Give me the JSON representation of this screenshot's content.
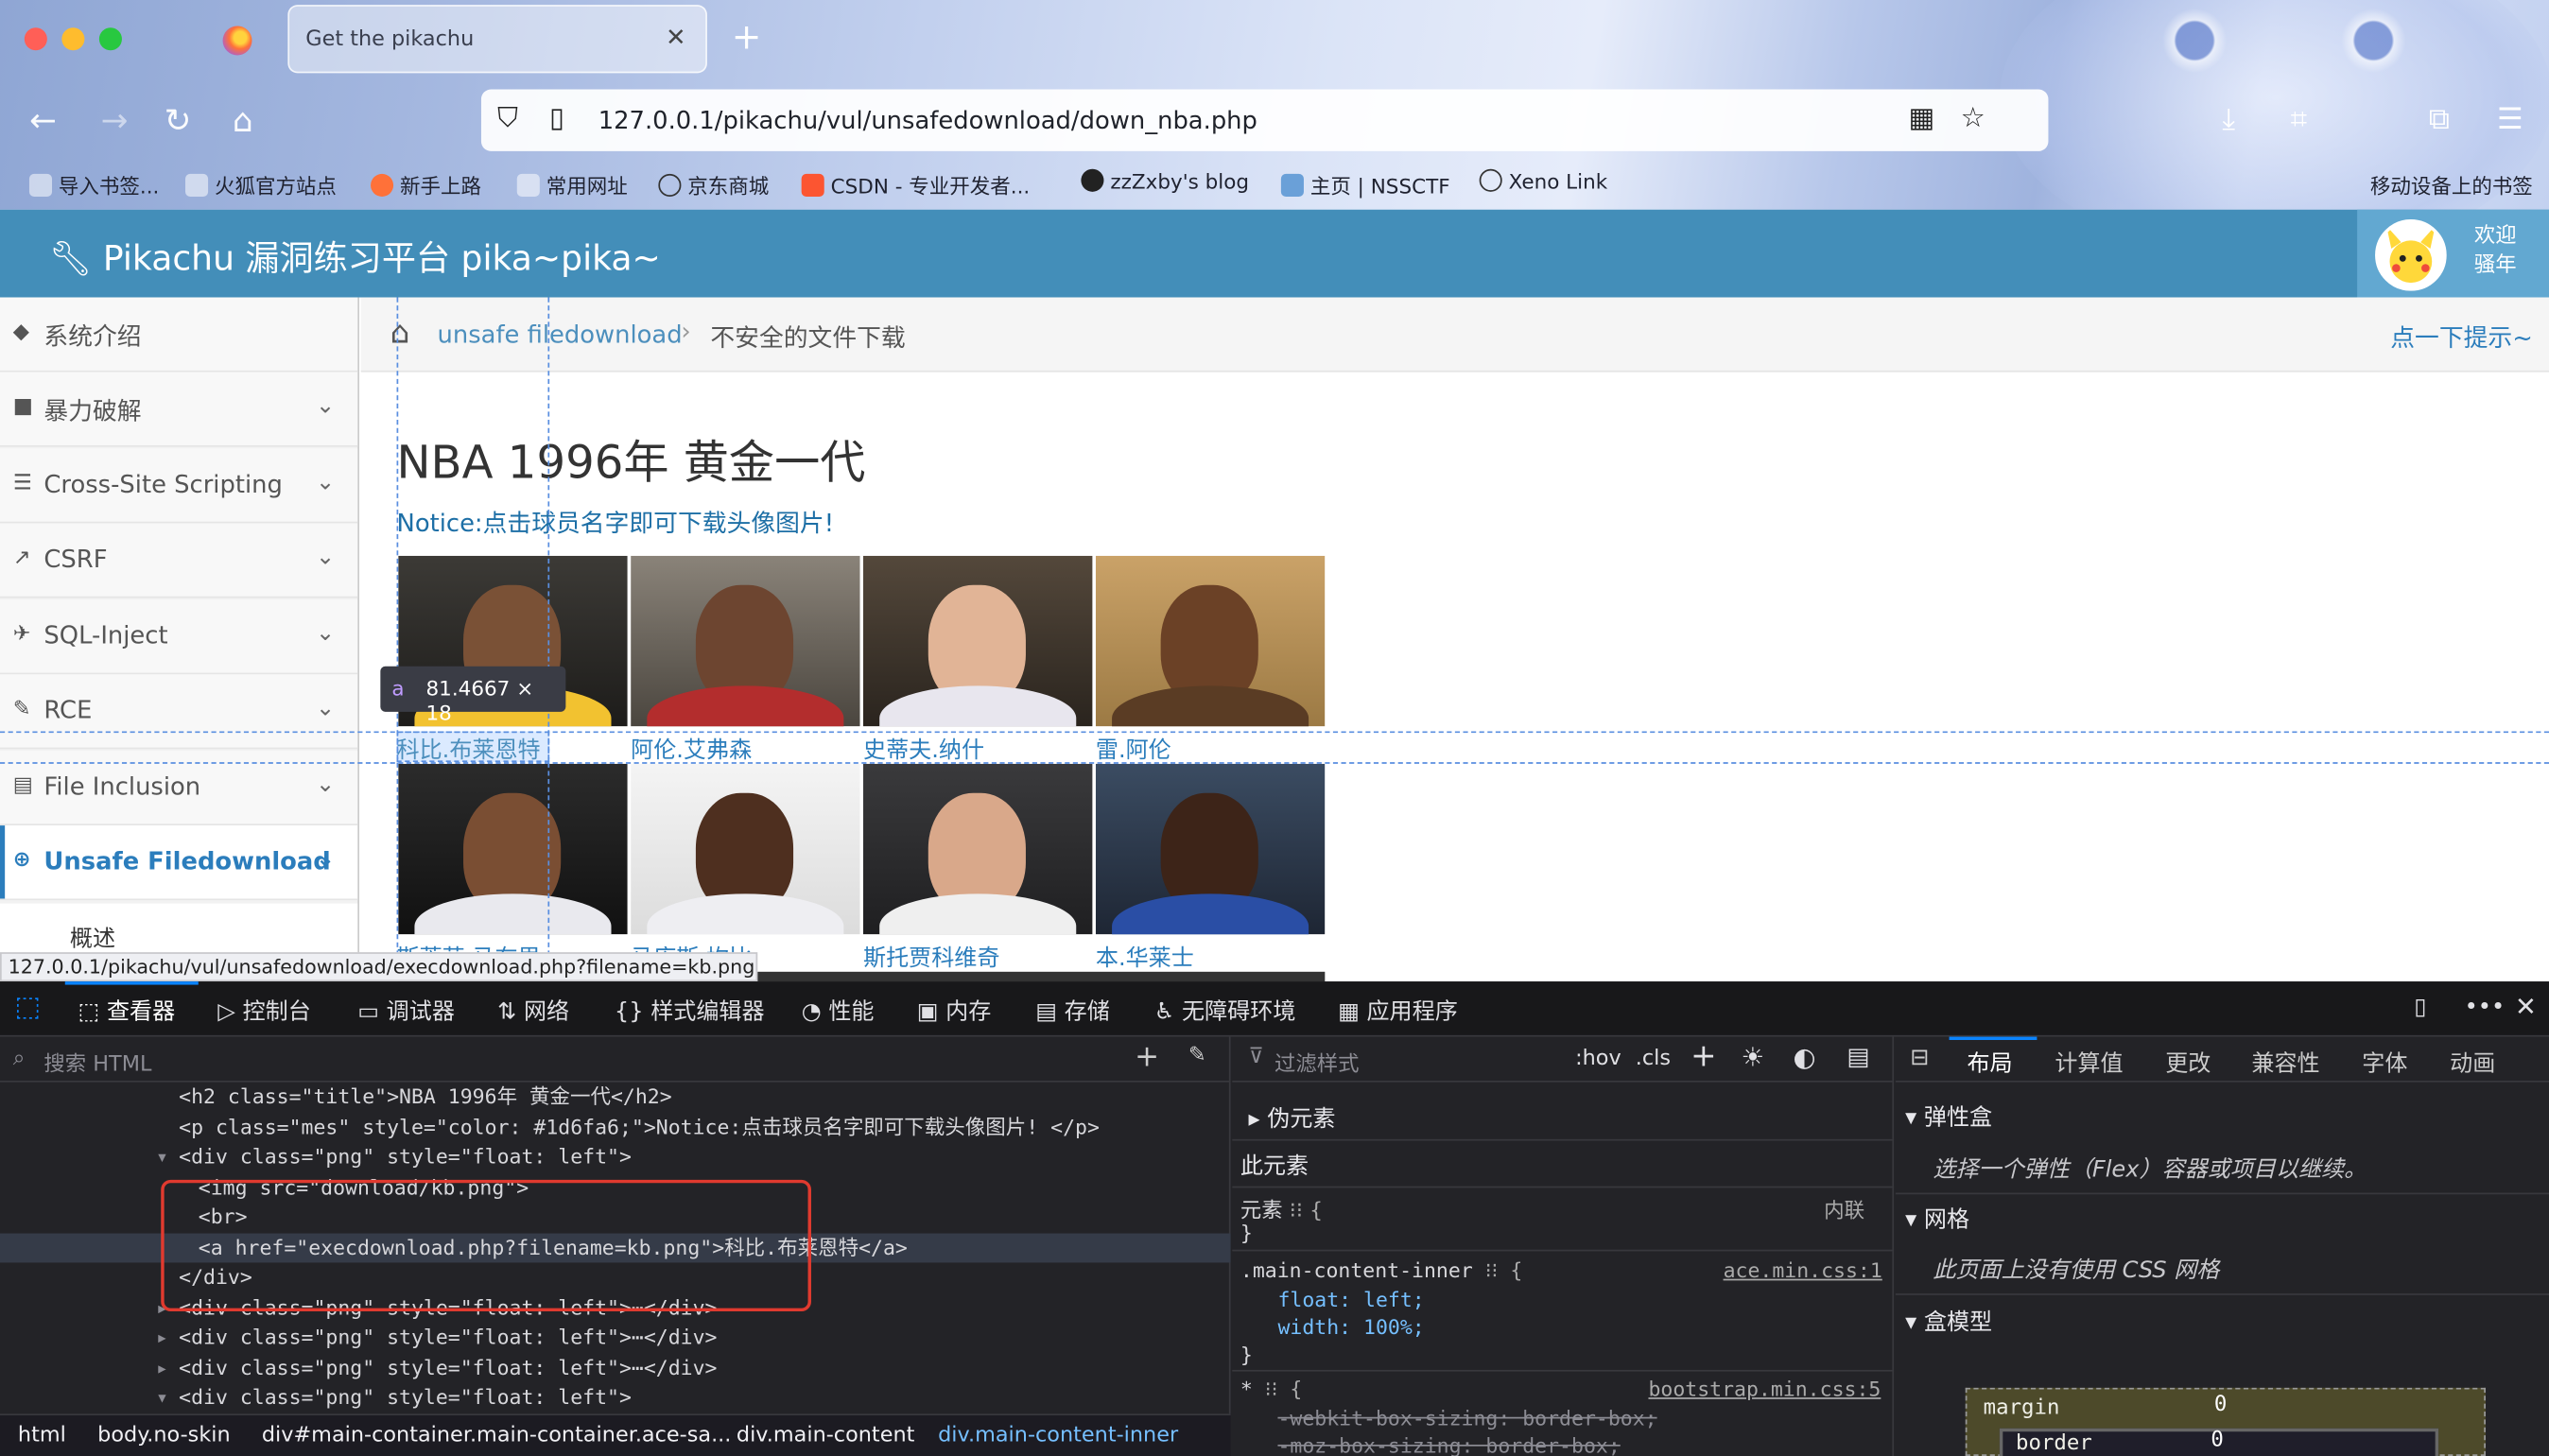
{
  "browser": {
    "tab_title": "Get the pikachu",
    "url": "127.0.0.1/pikachu/vul/unsafedownload/down_nba.php",
    "bookmarks": [
      "导入书签...",
      "火狐官方站点",
      "新手上路",
      "常用网址",
      "京东商城",
      "CSDN - 专业开发者...",
      "zzZxby's blog",
      "主页 | NSSCTF",
      "Xeno Link"
    ],
    "mobile_bookmarks": "移动设备上的书签",
    "status_url": "127.0.0.1/pikachu/vul/unsafedownload/execdownload.php?filename=kb.png"
  },
  "header": {
    "title": "Pikachu 漏洞练习平台 pika~pika~",
    "welcome_line1": "欢迎",
    "welcome_line2": "骚年"
  },
  "sidebar": {
    "items": [
      {
        "label": "系统介绍",
        "icon": "tags-icon"
      },
      {
        "label": "暴力破解",
        "icon": "lock-icon"
      },
      {
        "label": "Cross-Site Scripting",
        "icon": "list-icon"
      },
      {
        "label": "CSRF",
        "icon": "share-icon"
      },
      {
        "label": "SQL-Inject",
        "icon": "plane-icon"
      },
      {
        "label": "RCE",
        "icon": "pencil-icon"
      },
      {
        "label": "File Inclusion",
        "icon": "file-icon"
      },
      {
        "label": "Unsafe Filedownload",
        "icon": "download-icon"
      }
    ],
    "sub_item": "概述"
  },
  "breadcrumb": {
    "link": "unsafe filedownload",
    "current": "不安全的文件下载",
    "hint": "点一下提示~"
  },
  "main": {
    "title": "NBA 1996年 黄金一代",
    "notice": "Notice:点击球员名字即可下载头像图片!",
    "players": [
      "科比.布莱恩特",
      "阿伦.艾弗森",
      "史蒂夫.纳什",
      "雷.阿伦",
      "斯蒂芬.马布里",
      "马库斯.坎比",
      "斯托贾科维奇",
      "本.华莱士"
    ],
    "highlight_tag": "a",
    "highlight_dims": "81.4667 × 18"
  },
  "devtools": {
    "tabs": [
      "查看器",
      "控制台",
      "调试器",
      "网络",
      "样式编辑器",
      "性能",
      "内存",
      "存储",
      "无障碍环境",
      "应用程序"
    ],
    "search_placeholder": "搜索 HTML",
    "html_lines": [
      "<h2 class=\"title\">NBA 1996年 黄金一代</h2>",
      "<p class=\"mes\" style=\"color: #1d6fa6;\">Notice:点击球员名字即可下载头像图片! </p>",
      "<div class=\"png\" style=\"float: left\">",
      "<img src=\"download/kb.png\">",
      "<br>",
      "<a href=\"execdownload.php?filename=kb.png\">科比.布莱恩特</a>",
      "</div>",
      "<div class=\"png\" style=\"float: left\">⋯</div>",
      "<div class=\"png\" style=\"float: left\">⋯</div>",
      "<div class=\"png\" style=\"float: left\">⋯</div>",
      "<div class=\"png\" style=\"float: left\">"
    ],
    "breadcrumbs": [
      "html",
      "body.no-skin",
      "div#main-container.main-container.ace-sa...",
      "div.main-content",
      "div.main-content-inner"
    ],
    "rules": {
      "filter_placeholder": "过滤样式",
      "hov": ":hov",
      "cls": ".cls",
      "pseudo": "伪元素",
      "this_element": "此元素",
      "element_selector": "元素",
      "inline": "内联",
      "rule1_selector": ".main-content-inner",
      "rule1_source": "ace.min.css:1",
      "rule1_props": [
        "float: left;",
        "width: 100%;"
      ],
      "rule2_selector": "*",
      "rule2_source": "bootstrap.min.css:5",
      "rule2_props": [
        "-webkit-box-sizing: border-box;",
        "-moz-box-sizing: border-box;"
      ]
    },
    "layout_tabs": [
      "布局",
      "计算值",
      "更改",
      "兼容性",
      "字体",
      "动画"
    ],
    "flex_title": "弹性盒",
    "flex_text": "选择一个弹性（Flex）容器或项目以继续。",
    "grid_title": "网格",
    "grid_text": "此页面上没有使用 CSS 网格",
    "boxmodel_title": "盒模型",
    "margin_label": "margin",
    "margin_value": "0",
    "border_label": "border",
    "border_value": "0"
  }
}
